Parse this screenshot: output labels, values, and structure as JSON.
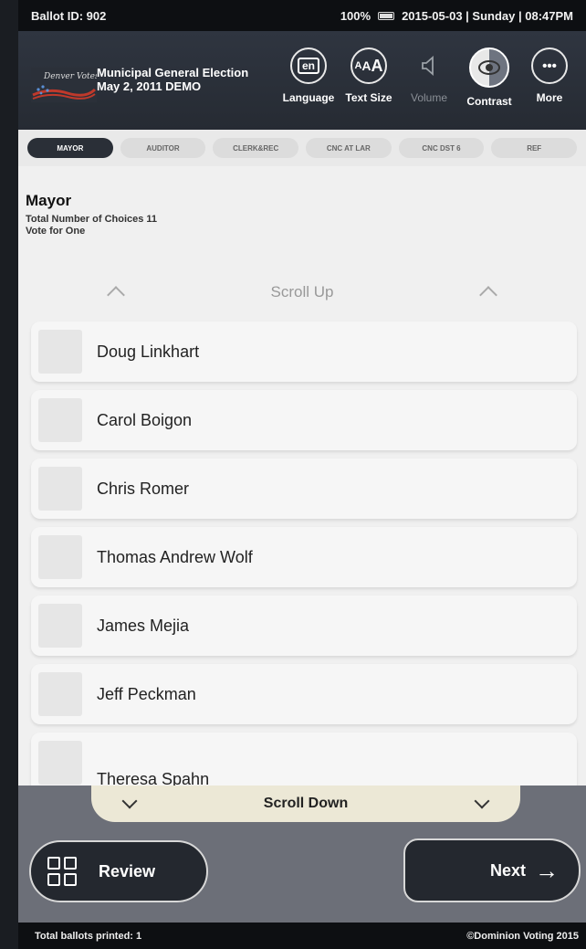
{
  "status": {
    "ballot_id": "Ballot ID: 902",
    "battery": "100%",
    "datetime": "2015-05-03 | Sunday | 08:47PM"
  },
  "header": {
    "logo_text": "Denver Votes!",
    "election_name": "Municipal General Election",
    "election_date": "May 2, 2011 DEMO",
    "tools": {
      "language": {
        "label": "Language",
        "icon": "en"
      },
      "text_size": {
        "label": "Text Size",
        "icon": "AAA"
      },
      "volume": {
        "label": "Volume"
      },
      "contrast": {
        "label": "Contrast"
      },
      "more": {
        "label": "More",
        "icon": "•••"
      }
    }
  },
  "tabs": [
    "MAYOR",
    "AUDITOR",
    "CLERK&REC",
    "CNC AT LAR",
    "CNC DST 6",
    "REF"
  ],
  "contest": {
    "title": "Mayor",
    "total_choices": "Total Number of Choices 11",
    "vote_for": "Vote for One"
  },
  "scroll_up_label": "Scroll Up",
  "scroll_down_label": "Scroll Down",
  "choices": [
    "Doug Linkhart",
    "Carol Boigon",
    "Chris Romer",
    "Thomas Andrew Wolf",
    "James Mejia",
    "Jeff Peckman",
    "Theresa Spahn"
  ],
  "buttons": {
    "review": "Review",
    "next": "Next",
    "next_arrow": "→"
  },
  "footer": {
    "ballots_printed": "Total ballots printed: 1",
    "copyright": "©Dominion Voting 2015"
  },
  "colors": {
    "header_bg": "#2b3039",
    "active_tab": "#2a2f37",
    "scroll_down_bg": "#ece8d6",
    "footer_bg": "#6c6f78"
  }
}
